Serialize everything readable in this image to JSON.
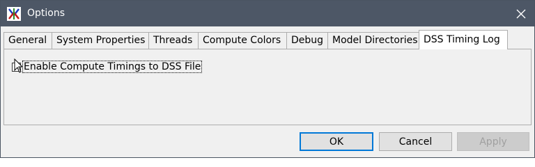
{
  "window": {
    "title": "Options",
    "close_icon": "close-icon",
    "app_icon": "app-logo-icon"
  },
  "tabs": [
    {
      "label": "General",
      "active": false
    },
    {
      "label": "System Properties",
      "active": false
    },
    {
      "label": "Threads",
      "active": false
    },
    {
      "label": "Compute Colors",
      "active": false
    },
    {
      "label": "Debug",
      "active": false
    },
    {
      "label": "Model Directories",
      "active": false
    },
    {
      "label": "DSS Timing Log",
      "active": true
    }
  ],
  "panel": {
    "checkbox_label": "Enable Compute Timings to DSS File",
    "checkbox_checked": false
  },
  "buttons": {
    "ok": "OK",
    "cancel": "Cancel",
    "apply": "Apply"
  },
  "colors": {
    "titlebar": "#4d5766",
    "focus_border": "#0078d7"
  }
}
